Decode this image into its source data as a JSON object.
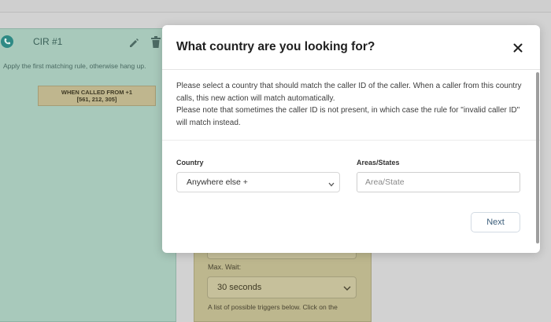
{
  "background": {
    "card": {
      "title": "CIR #1",
      "description": "Apply the first matching rule, otherwise hang up.",
      "rule_line1": "WHEN CALLED FROM +1",
      "rule_line2": "[561, 212, 305]"
    },
    "panel": {
      "max_wait_label": "Max. Wait:",
      "max_wait_value": "30 seconds",
      "triggers_hint": "A list of possible triggers below. Click on the"
    }
  },
  "modal": {
    "title": "What country are you looking for?",
    "paragraph1": "Please select a country that should match the caller ID of the caller. When a caller from this country calls, this new action will match automatically.",
    "paragraph2": "Please note that sometimes the caller ID is not present, in which case the rule for \"invalid caller ID\" will match instead.",
    "country_label": "Country",
    "country_value": "Anywhere else +",
    "areas_label": "Areas/States",
    "areas_placeholder": "Area/State",
    "next_label": "Next"
  },
  "colors": {
    "card_bg": "#a8c9bb",
    "panel_bg": "#bdb78e",
    "accent": "#2f8a85",
    "next_text": "#3b5d7a"
  },
  "icons": {
    "avatar": "phone-avatar-icon",
    "edit": "pencil-icon",
    "delete": "trash-icon",
    "close": "close-icon",
    "select_chevron": "chevron-down-icon"
  }
}
